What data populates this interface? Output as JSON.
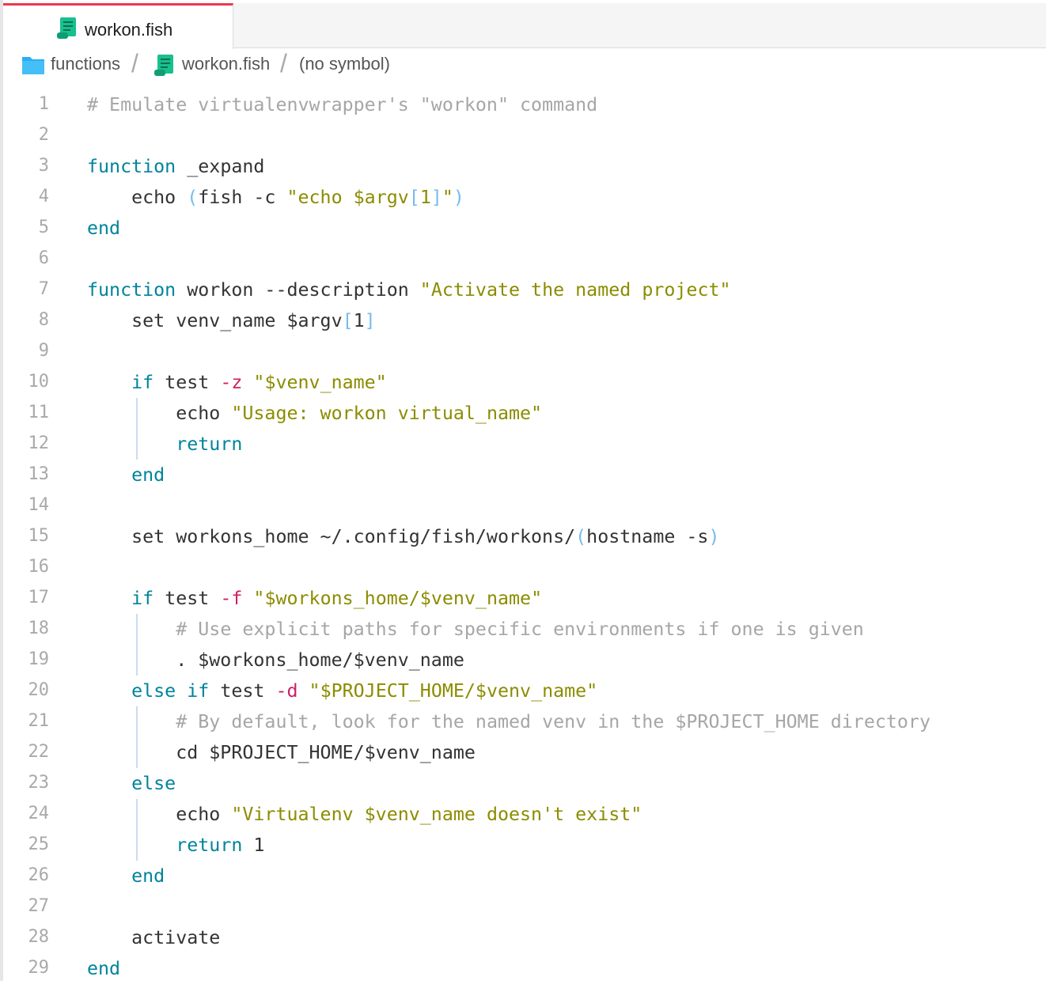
{
  "tab": {
    "label": "workon.fish"
  },
  "breadcrumb": {
    "items": [
      {
        "label": "functions",
        "icon": "folder-icon"
      },
      {
        "label": "workon.fish",
        "icon": "script-file-icon"
      },
      {
        "label": "(no symbol)"
      }
    ]
  },
  "colors": {
    "tab_accent": "#ea3a4c",
    "keyword": "#00849b",
    "string": "#8c8c00",
    "comment": "#a6a6a6",
    "flag": "#d11e63",
    "bracket": "#74bcee"
  },
  "editor": {
    "lines": [
      {
        "num": "1",
        "tokens": [
          {
            "t": "# Emulate virtualenvwrapper's \"workon\" command",
            "c": "comment"
          }
        ]
      },
      {
        "num": "2",
        "tokens": []
      },
      {
        "num": "3",
        "tokens": [
          {
            "t": "function",
            "c": "keyword"
          },
          {
            "t": " _expand",
            "c": "plain"
          }
        ]
      },
      {
        "num": "4",
        "tokens": [
          {
            "t": "    echo ",
            "c": "plain"
          },
          {
            "t": "(",
            "c": "bracket"
          },
          {
            "t": "fish -c ",
            "c": "plain"
          },
          {
            "t": "\"echo $argv",
            "c": "string"
          },
          {
            "t": "[",
            "c": "bracket"
          },
          {
            "t": "1",
            "c": "string"
          },
          {
            "t": "]",
            "c": "bracket"
          },
          {
            "t": "\"",
            "c": "string"
          },
          {
            "t": ")",
            "c": "bracket"
          }
        ]
      },
      {
        "num": "5",
        "tokens": [
          {
            "t": "end",
            "c": "keyword"
          }
        ]
      },
      {
        "num": "6",
        "tokens": []
      },
      {
        "num": "7",
        "tokens": [
          {
            "t": "function",
            "c": "keyword"
          },
          {
            "t": " workon --description ",
            "c": "plain"
          },
          {
            "t": "\"Activate the named project\"",
            "c": "string"
          }
        ]
      },
      {
        "num": "8",
        "tokens": [
          {
            "t": "    set venv_name $argv",
            "c": "plain"
          },
          {
            "t": "[",
            "c": "bracket"
          },
          {
            "t": "1",
            "c": "plain"
          },
          {
            "t": "]",
            "c": "bracket"
          }
        ]
      },
      {
        "num": "9",
        "tokens": []
      },
      {
        "num": "10",
        "tokens": [
          {
            "t": "    ",
            "c": "plain"
          },
          {
            "t": "if",
            "c": "keyword"
          },
          {
            "t": " test ",
            "c": "plain"
          },
          {
            "t": "-z",
            "c": "flag"
          },
          {
            "t": " ",
            "c": "plain"
          },
          {
            "t": "\"$venv_name\"",
            "c": "string"
          }
        ]
      },
      {
        "num": "11",
        "tokens": [
          {
            "t": "        echo ",
            "c": "plain"
          },
          {
            "t": "\"Usage: workon virtual_name\"",
            "c": "string"
          }
        ]
      },
      {
        "num": "12",
        "tokens": [
          {
            "t": "        ",
            "c": "plain"
          },
          {
            "t": "return",
            "c": "keyword"
          }
        ]
      },
      {
        "num": "13",
        "tokens": [
          {
            "t": "    ",
            "c": "plain"
          },
          {
            "t": "end",
            "c": "keyword"
          }
        ]
      },
      {
        "num": "14",
        "tokens": []
      },
      {
        "num": "15",
        "tokens": [
          {
            "t": "    set workons_home ~/.config/fish/workons/",
            "c": "plain"
          },
          {
            "t": "(",
            "c": "bracket"
          },
          {
            "t": "hostname -s",
            "c": "plain"
          },
          {
            "t": ")",
            "c": "bracket"
          }
        ]
      },
      {
        "num": "16",
        "tokens": []
      },
      {
        "num": "17",
        "tokens": [
          {
            "t": "    ",
            "c": "plain"
          },
          {
            "t": "if",
            "c": "keyword"
          },
          {
            "t": " test ",
            "c": "plain"
          },
          {
            "t": "-f",
            "c": "flag"
          },
          {
            "t": " ",
            "c": "plain"
          },
          {
            "t": "\"$workons_home/$venv_name\"",
            "c": "string"
          }
        ]
      },
      {
        "num": "18",
        "tokens": [
          {
            "t": "        ",
            "c": "plain"
          },
          {
            "t": "# Use explicit paths for specific environments if one is given",
            "c": "comment"
          }
        ]
      },
      {
        "num": "19",
        "tokens": [
          {
            "t": "        . $workons_home/$venv_name",
            "c": "plain"
          }
        ]
      },
      {
        "num": "20",
        "tokens": [
          {
            "t": "    ",
            "c": "plain"
          },
          {
            "t": "else if",
            "c": "keyword"
          },
          {
            "t": " test ",
            "c": "plain"
          },
          {
            "t": "-d",
            "c": "flag"
          },
          {
            "t": " ",
            "c": "plain"
          },
          {
            "t": "\"$PROJECT_HOME/$venv_name\"",
            "c": "string"
          }
        ]
      },
      {
        "num": "21",
        "tokens": [
          {
            "t": "        ",
            "c": "plain"
          },
          {
            "t": "# By default, look for the named venv in the $PROJECT_HOME directory",
            "c": "comment"
          }
        ]
      },
      {
        "num": "22",
        "tokens": [
          {
            "t": "        cd $PROJECT_HOME/$venv_name",
            "c": "plain"
          }
        ]
      },
      {
        "num": "23",
        "tokens": [
          {
            "t": "    ",
            "c": "plain"
          },
          {
            "t": "else",
            "c": "keyword"
          }
        ]
      },
      {
        "num": "24",
        "tokens": [
          {
            "t": "        echo ",
            "c": "plain"
          },
          {
            "t": "\"Virtualenv $venv_name doesn't exist\"",
            "c": "string"
          }
        ]
      },
      {
        "num": "25",
        "tokens": [
          {
            "t": "        ",
            "c": "plain"
          },
          {
            "t": "return",
            "c": "keyword"
          },
          {
            "t": " 1",
            "c": "plain"
          }
        ]
      },
      {
        "num": "26",
        "tokens": [
          {
            "t": "    ",
            "c": "plain"
          },
          {
            "t": "end",
            "c": "keyword"
          }
        ]
      },
      {
        "num": "27",
        "tokens": []
      },
      {
        "num": "28",
        "tokens": [
          {
            "t": "    activate",
            "c": "plain"
          }
        ]
      },
      {
        "num": "29",
        "tokens": [
          {
            "t": "end",
            "c": "keyword"
          }
        ]
      }
    ]
  }
}
